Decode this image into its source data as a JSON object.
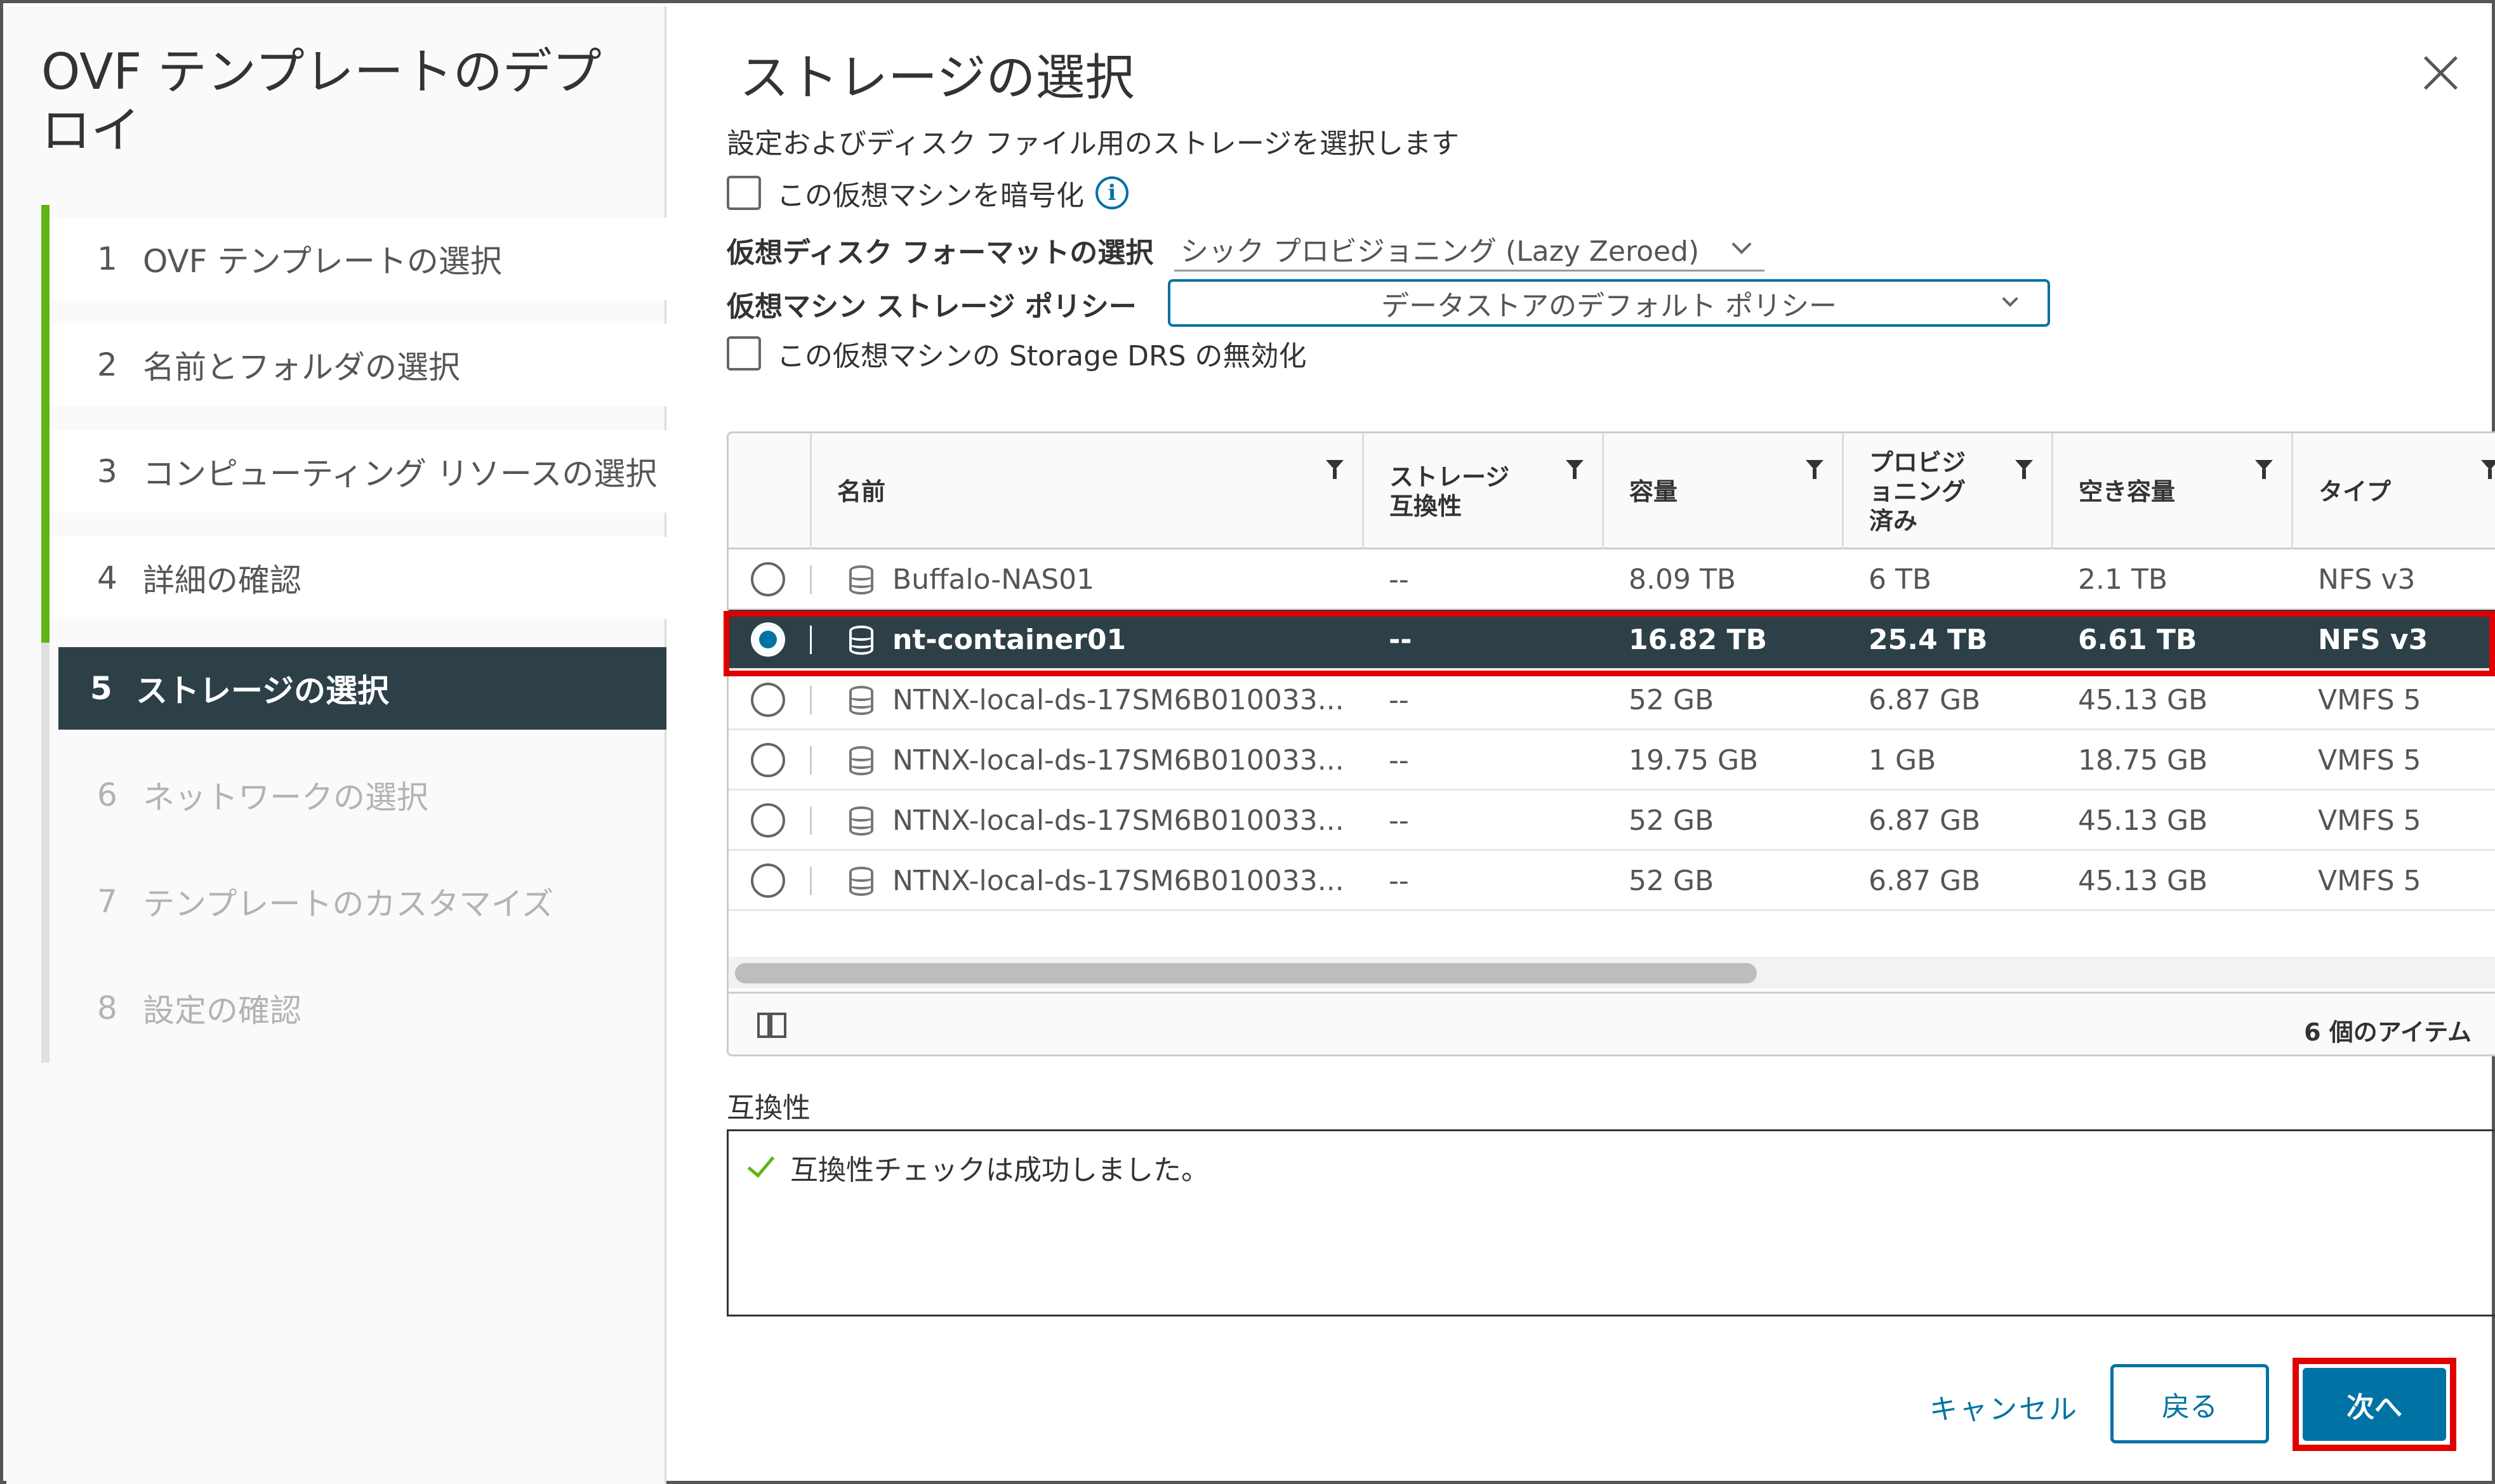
{
  "sidebar": {
    "title": "OVF テンプレートのデプロイ",
    "steps": [
      {
        "num": "1",
        "label": "OVF テンプレートの選択"
      },
      {
        "num": "2",
        "label": "名前とフォルダの選択"
      },
      {
        "num": "3",
        "label": "コンピューティング リソースの選択"
      },
      {
        "num": "4",
        "label": "詳細の確認"
      },
      {
        "num": "5",
        "label": "ストレージの選択"
      },
      {
        "num": "6",
        "label": "ネットワークの選択"
      },
      {
        "num": "7",
        "label": "テンプレートのカスタマイズ"
      },
      {
        "num": "8",
        "label": "設定の確認"
      }
    ]
  },
  "main": {
    "title": "ストレージの選択",
    "subtitle": "設定およびディスク ファイル用のストレージを選択します",
    "encrypt_label": "この仮想マシンを暗号化",
    "disk_format_label": "仮想ディスク フォーマットの選択",
    "disk_format_value": "シック プロビジョニング (Lazy Zeroed)",
    "storage_policy_label": "仮想マシン ストレージ ポリシー",
    "storage_policy_value": "データストアのデフォルト ポリシー",
    "drs_label": "この仮想マシンの Storage DRS の無効化"
  },
  "grid": {
    "columns": [
      "名前",
      "ストレージ互換性",
      "容量",
      "プロビジョニング済み",
      "空き容量",
      "タイプ"
    ],
    "columns_display": {
      "name": "名前",
      "compat_1": "ストレージ",
      "compat_2": "互換性",
      "capacity": "容量",
      "prov_1": "プロビジ",
      "prov_2": "ョニング",
      "prov_3": "済み",
      "free": "空き容量",
      "type": "タイプ"
    },
    "rows": [
      {
        "name": "Buffalo-NAS01",
        "compat": "--",
        "capacity": "8.09 TB",
        "provisioned": "6 TB",
        "free": "2.1 TB",
        "type": "NFS v3",
        "selected": false
      },
      {
        "name": "nt-container01",
        "compat": "--",
        "capacity": "16.82 TB",
        "provisioned": "25.4 TB",
        "free": "6.61 TB",
        "type": "NFS v3",
        "selected": true
      },
      {
        "name": "NTNX-local-ds-17SM6B010033...",
        "compat": "--",
        "capacity": "52 GB",
        "provisioned": "6.87 GB",
        "free": "45.13 GB",
        "type": "VMFS 5",
        "selected": false
      },
      {
        "name": "NTNX-local-ds-17SM6B010033...",
        "compat": "--",
        "capacity": "19.75 GB",
        "provisioned": "1 GB",
        "free": "18.75 GB",
        "type": "VMFS 5",
        "selected": false
      },
      {
        "name": "NTNX-local-ds-17SM6B010033...",
        "compat": "--",
        "capacity": "52 GB",
        "provisioned": "6.87 GB",
        "free": "45.13 GB",
        "type": "VMFS 5",
        "selected": false
      },
      {
        "name": "NTNX-local-ds-17SM6B010033...",
        "compat": "--",
        "capacity": "52 GB",
        "provisioned": "6.87 GB",
        "free": "45.13 GB",
        "type": "VMFS 5",
        "selected": false
      }
    ],
    "item_count": "6 個のアイテム"
  },
  "compatibility": {
    "label": "互換性",
    "message": "互換性チェックは成功しました。"
  },
  "footer": {
    "cancel": "キャンセル",
    "back": "戻る",
    "next": "次へ"
  },
  "colors": {
    "accent": "#0072a3",
    "selected_row": "#2d4047",
    "progress_green": "#60b515",
    "highlight_red": "#e00000"
  }
}
